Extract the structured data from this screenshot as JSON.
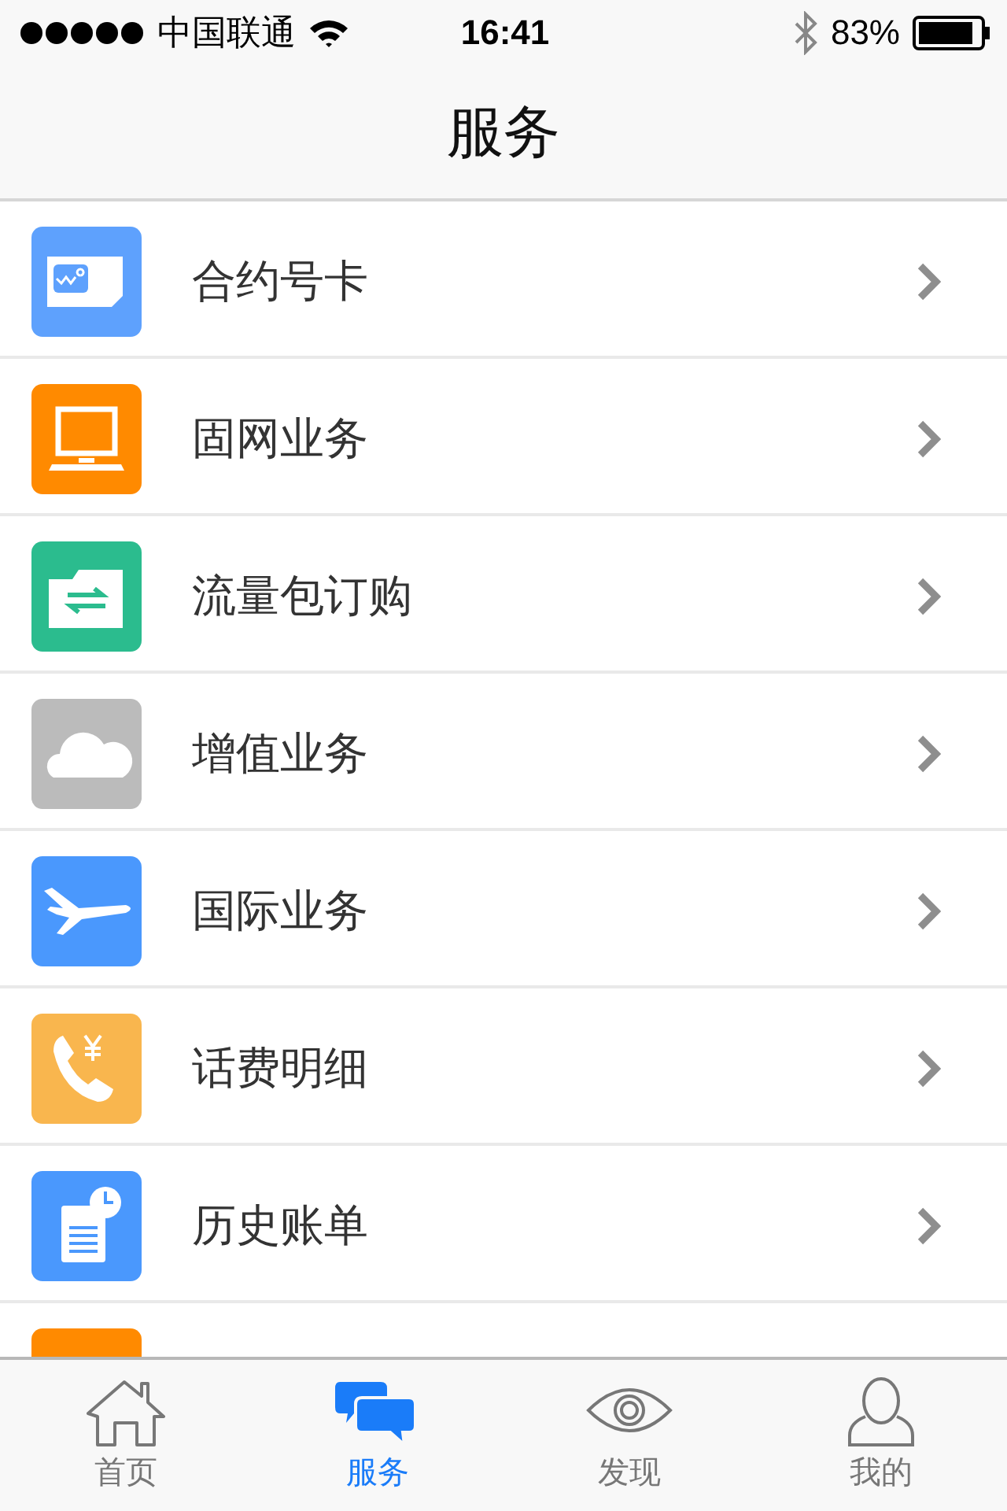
{
  "status_bar": {
    "carrier": "中国联通",
    "time": "16:41",
    "battery": "83%"
  },
  "nav_bar": {
    "title": "服务"
  },
  "items": [
    {
      "kind": "sim",
      "color": "#5ea1fd",
      "label": "合约号卡"
    },
    {
      "kind": "computer",
      "color": "#ff8a00",
      "label": "固网业务"
    },
    {
      "kind": "transfer",
      "color": "#2bbc8e",
      "label": "流量包订购"
    },
    {
      "kind": "cloud",
      "color": "#bbbbbb",
      "label": "增值业务"
    },
    {
      "kind": "plane",
      "color": "#4a98fd",
      "label": "国际业务"
    },
    {
      "kind": "phone",
      "color": "#f9b64e",
      "label": "话费明细"
    },
    {
      "kind": "bill",
      "color": "#4a98fd",
      "label": "历史账单"
    },
    {
      "kind": "partial",
      "color": "#ff8a00"
    }
  ],
  "tab_bar": [
    {
      "kind": "home",
      "label": "首页",
      "selected": false
    },
    {
      "kind": "chat",
      "label": "服务",
      "selected": true
    },
    {
      "kind": "eye",
      "label": "发现",
      "selected": false
    },
    {
      "kind": "person",
      "label": "我的",
      "selected": false
    }
  ]
}
